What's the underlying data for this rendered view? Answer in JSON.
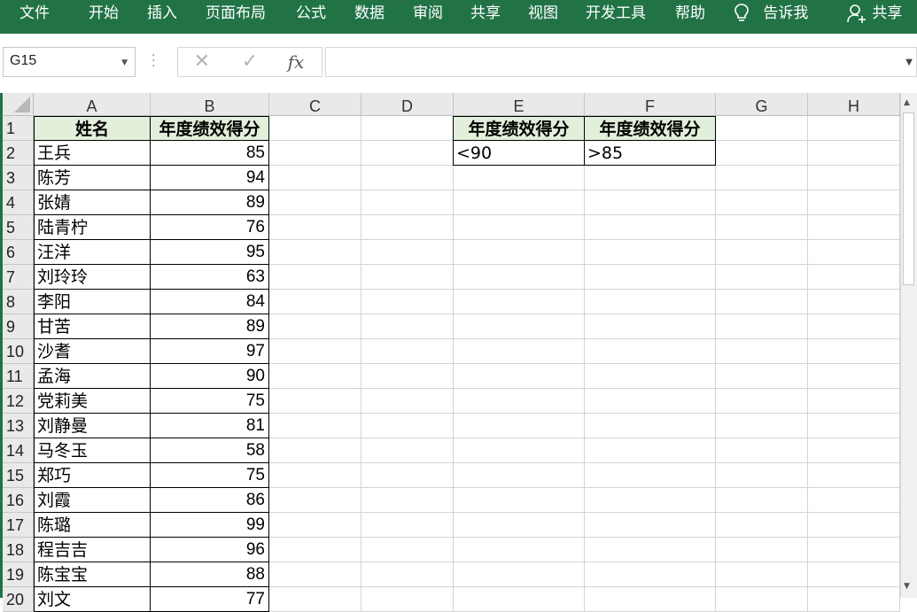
{
  "ribbon": {
    "tabs": [
      "文件",
      "开始",
      "插入",
      "页面布局",
      "公式",
      "数据",
      "审阅",
      "共享",
      "视图",
      "开发工具",
      "帮助"
    ],
    "tell_me": "告诉我",
    "share": "共享"
  },
  "formula_bar": {
    "name_box": "G15",
    "cancel_glyph": "✕",
    "enter_glyph": "✓",
    "fx_glyph": "fx",
    "formula": ""
  },
  "columns": [
    "A",
    "B",
    "C",
    "D",
    "E",
    "F",
    "G",
    "H"
  ],
  "rows": [
    "1",
    "2",
    "3",
    "4",
    "5",
    "6",
    "7",
    "8",
    "9",
    "10",
    "11",
    "12",
    "13",
    "14",
    "15",
    "16",
    "17",
    "18",
    "19",
    "20"
  ],
  "table": {
    "header_name": "姓名",
    "header_score": "年度绩效得分",
    "names": [
      "王兵",
      "陈芳",
      "张婧",
      "陆青柠",
      "汪洋",
      "刘玲玲",
      "李阳",
      "甘苦",
      "沙耆",
      "孟海",
      "党莉美",
      "刘静曼",
      "马冬玉",
      "郑巧",
      "刘霞",
      "陈璐",
      "程吉吉",
      "陈宝宝",
      "刘文"
    ],
    "scores": [
      "85",
      "94",
      "89",
      "76",
      "95",
      "63",
      "84",
      "89",
      "97",
      "90",
      "75",
      "81",
      "58",
      "75",
      "86",
      "99",
      "96",
      "88",
      "77"
    ]
  },
  "criteria": {
    "header_e": "年度绩效得分",
    "header_f": "年度绩效得分",
    "value_e": "<90",
    "value_f": ">85"
  },
  "colors": {
    "ribbon": "#217346",
    "header_fill": "#e2efda"
  }
}
